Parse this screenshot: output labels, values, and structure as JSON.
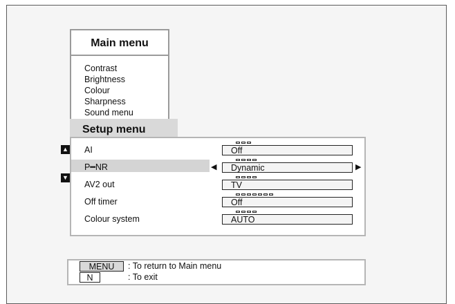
{
  "main_menu": {
    "title": "Main menu",
    "items": [
      "Contrast",
      "Brightness",
      "Colour",
      "Sharpness",
      "Sound menu"
    ]
  },
  "setup_menu": {
    "title": "Setup menu",
    "scroll_up_icon": "triangle-up",
    "scroll_down_icon": "triangle-down",
    "rows": [
      {
        "label": "AI",
        "value": "Off",
        "dots": 3,
        "selected": false
      },
      {
        "label": "P━NR",
        "value": "Dynamic",
        "dots": 4,
        "selected": true
      },
      {
        "label": "AV2 out",
        "value": "TV",
        "dots": 4,
        "selected": false
      },
      {
        "label": "Off timer",
        "value": "Off",
        "dots": 7,
        "selected": false
      },
      {
        "label": "Colour system",
        "value": "AUTO",
        "dots": 4,
        "selected": false
      }
    ]
  },
  "help": {
    "menu_key": "MENU",
    "menu_desc": ": To return to Main menu",
    "exit_key": "N",
    "exit_desc": ": To exit"
  },
  "colors": {
    "panel_bg": "#ffffff",
    "highlight": "#d4d4d4",
    "frame_bg": "#f5f5f5"
  }
}
